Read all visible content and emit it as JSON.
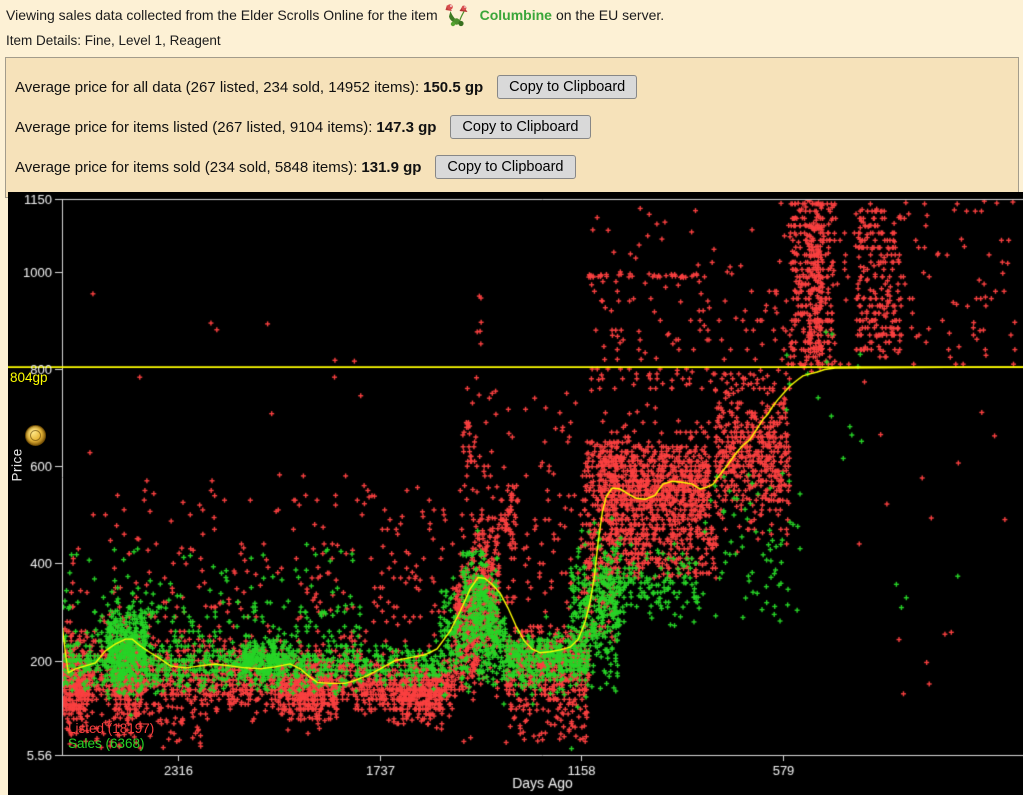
{
  "header": {
    "line1_pre": "Viewing sales data collected from the Elder Scrolls Online for the item",
    "item_name": "Columbine",
    "line1_post": " on the EU server.",
    "line2": "Item Details: Fine, Level 1, Reagent"
  },
  "stats": {
    "copy_button_label": "Copy to Clipboard",
    "rows": [
      {
        "label": "Average price for all data (267 listed, 234 sold, 14952 items):",
        "value": "150.5 gp"
      },
      {
        "label": "Average price for items listed (267 listed, 9104 items):",
        "value": "147.3 gp"
      },
      {
        "label": "Average price for items sold (234 sold, 5848 items):",
        "value": "131.9 gp"
      }
    ]
  },
  "chart_data": {
    "type": "scatter",
    "title": "",
    "xlabel": "Days Ago",
    "ylabel": "Price",
    "x_axis": {
      "label": "Days Ago",
      "ticks": [
        2316,
        1737,
        1158,
        579
      ],
      "range": [
        2650,
        -110
      ],
      "inverted": true
    },
    "y_axis": {
      "label": "Price",
      "tick_labels": [
        "1150",
        "1000",
        "800",
        "600",
        "400",
        "200",
        "5.56"
      ],
      "tick_values": [
        1150,
        1000,
        800,
        600,
        400,
        200,
        5.56
      ],
      "range": [
        5.56,
        1150
      ]
    },
    "grid": false,
    "background": "#000000",
    "axis_color": "#d8d8d8",
    "text_color": "#f2f2f2",
    "hline": {
      "value": 804,
      "label": "804gp",
      "color": "#ffff00"
    },
    "legend": [
      {
        "label": "Listed (18197)",
        "color": "#fa4040",
        "count": 18197
      },
      {
        "label": "Sales (6368)",
        "color": "#27d427",
        "count": 6368
      }
    ],
    "trend_line": {
      "color": "#ffff00",
      "points": [
        [
          2649,
          270
        ],
        [
          2640,
          215
        ],
        [
          2632,
          175
        ],
        [
          2611,
          183
        ],
        [
          2583,
          189
        ],
        [
          2554,
          195
        ],
        [
          2525,
          220
        ],
        [
          2497,
          234
        ],
        [
          2468,
          244
        ],
        [
          2448,
          244
        ],
        [
          2425,
          230
        ],
        [
          2396,
          216
        ],
        [
          2373,
          206
        ],
        [
          2339,
          189
        ],
        [
          2296,
          185
        ],
        [
          2253,
          189
        ],
        [
          2210,
          193
        ],
        [
          2167,
          189
        ],
        [
          2124,
          185
        ],
        [
          2081,
          183
        ],
        [
          2038,
          187
        ],
        [
          1995,
          193
        ],
        [
          1966,
          183
        ],
        [
          1943,
          169
        ],
        [
          1917,
          155
        ],
        [
          1880,
          153
        ],
        [
          1837,
          153
        ],
        [
          1808,
          159
        ],
        [
          1774,
          169
        ],
        [
          1736,
          183
        ],
        [
          1693,
          200
        ],
        [
          1650,
          206
        ],
        [
          1607,
          212
        ],
        [
          1573,
          224
        ],
        [
          1535,
          261
        ],
        [
          1506,
          302
        ],
        [
          1478,
          347
        ],
        [
          1455,
          371
        ],
        [
          1435,
          369
        ],
        [
          1415,
          357
        ],
        [
          1392,
          339
        ],
        [
          1369,
          308
        ],
        [
          1346,
          271
        ],
        [
          1323,
          241
        ],
        [
          1300,
          224
        ],
        [
          1277,
          216
        ],
        [
          1248,
          218
        ],
        [
          1219,
          222
        ],
        [
          1190,
          228
        ],
        [
          1167,
          244
        ],
        [
          1147,
          281
        ],
        [
          1133,
          322
        ],
        [
          1121,
          373
        ],
        [
          1110,
          445
        ],
        [
          1098,
          506
        ],
        [
          1087,
          537
        ],
        [
          1070,
          555
        ],
        [
          1047,
          553
        ],
        [
          1024,
          543
        ],
        [
          1001,
          534
        ],
        [
          975,
          532
        ],
        [
          947,
          540
        ],
        [
          924,
          563
        ],
        [
          898,
          569
        ],
        [
          869,
          567
        ],
        [
          840,
          563
        ],
        [
          817,
          553
        ],
        [
          797,
          557
        ],
        [
          780,
          563
        ],
        [
          760,
          583
        ],
        [
          737,
          604
        ],
        [
          717,
          624
        ],
        [
          697,
          641
        ],
        [
          674,
          655
        ],
        [
          654,
          677
        ],
        [
          637,
          696
        ],
        [
          622,
          708
        ],
        [
          608,
          724
        ],
        [
          594,
          737
        ],
        [
          579,
          749
        ],
        [
          559,
          765
        ],
        [
          539,
          777
        ],
        [
          522,
          786
        ],
        [
          502,
          790
        ],
        [
          481,
          794
        ],
        [
          460,
          799
        ],
        [
          430,
          802
        ],
        [
          0,
          804
        ],
        [
          -110,
          804
        ]
      ]
    },
    "scatter_clusters": [
      {
        "series": "listed",
        "days": [
          2650,
          2570
        ],
        "price": [
          150,
          45
        ],
        "dist": "gauss",
        "n": 260,
        "quant": 10
      },
      {
        "series": "listed",
        "days": [
          2650,
          1790
        ],
        "price": [
          152,
          28
        ],
        "dist": "gauss",
        "n": 900,
        "quant": 10
      },
      {
        "series": "listed",
        "days": [
          2650,
          1790
        ],
        "price": [
          205,
          22
        ],
        "dist": "gauss",
        "n": 280,
        "quant": 10
      },
      {
        "series": "listed",
        "days": [
          2500,
          2420
        ],
        "price": [
          165,
          45
        ],
        "dist": "gauss",
        "n": 220,
        "quant": 10
      },
      {
        "series": "listed",
        "days": [
          2030,
          1860
        ],
        "price": [
          130,
          28
        ],
        "dist": "gauss",
        "n": 260,
        "quant": 10
      },
      {
        "series": "listed",
        "days": [
          2650,
          1790
        ],
        "price": [
          240,
          450
        ],
        "dist": "uniform",
        "n": 150,
        "quant": 10
      },
      {
        "series": "listed",
        "days": [
          2650,
          1790
        ],
        "price": [
          450,
          580
        ],
        "dist": "uniform",
        "n": 40,
        "quant": 10
      },
      {
        "series": "listed",
        "days": [
          2650,
          1790
        ],
        "price": [
          580,
          1050
        ],
        "dist": "uniform",
        "n": 12,
        "quant": 0
      },
      {
        "series": "listed",
        "days": [
          2650,
          2250
        ],
        "price": [
          20,
          105
        ],
        "dist": "uniform",
        "n": 70,
        "quant": 0
      },
      {
        "series": "listed",
        "days": [
          1790,
          1520
        ],
        "price": [
          150,
          30
        ],
        "dist": "gauss",
        "n": 420,
        "quant": 10
      },
      {
        "series": "listed",
        "days": [
          1700,
          1555
        ],
        "price": [
          120,
          25
        ],
        "dist": "gauss",
        "n": 200,
        "quant": 10
      },
      {
        "series": "listed",
        "days": [
          1790,
          1500
        ],
        "price": [
          240,
          560
        ],
        "dist": "uniform",
        "n": 90,
        "quant": 10
      },
      {
        "series": "listed",
        "days": [
          1520,
          1460
        ],
        "price": [
          270,
          70
        ],
        "dist": "gauss",
        "n": 250,
        "quant": 0
      },
      {
        "series": "listed",
        "days": [
          1470,
          1395
        ],
        "price": [
          330,
          80
        ],
        "dist": "gauss",
        "n": 300,
        "quant": 0
      },
      {
        "series": "listed",
        "days": [
          1500,
          1420
        ],
        "price": [
          450,
          700
        ],
        "dist": "uniform",
        "n": 40,
        "quant": 10
      },
      {
        "series": "listed",
        "days": [
          1460,
          1445
        ],
        "price": [
          700,
          960
        ],
        "dist": "uniform",
        "n": 8,
        "quant": 0
      },
      {
        "series": "listed",
        "days": [
          1375,
          1135
        ],
        "price": [
          190,
          40
        ],
        "dist": "gauss",
        "n": 550,
        "quant": 10
      },
      {
        "series": "listed",
        "days": [
          1375,
          1135
        ],
        "price": [
          30,
          120
        ],
        "dist": "uniform",
        "n": 60,
        "quant": 0
      },
      {
        "series": "listed",
        "days": [
          1375,
          1135
        ],
        "price": [
          300,
          560
        ],
        "dist": "uniform",
        "n": 70,
        "quant": 10
      },
      {
        "series": "listed",
        "days": [
          1395,
          1340
        ],
        "price": [
          430,
          560
        ],
        "dist": "uniform",
        "n": 50,
        "quant": 10
      },
      {
        "series": "listed",
        "days": [
          1150,
          1055
        ],
        "price": [
          240,
          650
        ],
        "dist": "uniform",
        "n": 260,
        "quant": 10
      },
      {
        "series": "listed",
        "days": [
          1105,
          790
        ],
        "price": [
          560,
          55
        ],
        "dist": "gauss",
        "n": 950,
        "quant": 10
      },
      {
        "series": "listed",
        "days": [
          1085,
          770
        ],
        "price": [
          370,
          475
        ],
        "dist": "uniform",
        "n": 230,
        "quant": 10
      },
      {
        "series": "listed",
        "days": [
          775,
          560
        ],
        "price": [
          625,
          70
        ],
        "dist": "gauss",
        "n": 520,
        "quant": 10
      },
      {
        "series": "listed",
        "days": [
          1150,
          560
        ],
        "price": [
          755,
          800
        ],
        "dist": "uniform",
        "n": 60,
        "quant": 10
      },
      {
        "series": "listed",
        "days": [
          1150,
          560
        ],
        "price": [
          810,
          1000
        ],
        "dist": "uniform",
        "n": 90,
        "quant": 20
      },
      {
        "series": "listed",
        "days": [
          1140,
          790
        ],
        "price": [
          988,
          996
        ],
        "dist": "uniform",
        "n": 40,
        "quant": 0
      },
      {
        "series": "listed",
        "days": [
          1150,
          560
        ],
        "price": [
          1000,
          1150
        ],
        "dist": "uniform",
        "n": 25,
        "quant": 0
      },
      {
        "series": "listed",
        "days": [
          560,
          430
        ],
        "price": [
          800,
          1150
        ],
        "dist": "uniform",
        "n": 330,
        "quant": 15
      },
      {
        "series": "listed",
        "days": [
          505,
          465
        ],
        "price": [
          820,
          1150
        ],
        "dist": "uniform",
        "n": 120,
        "quant": 0
      },
      {
        "series": "listed",
        "days": [
          370,
          240
        ],
        "price": [
          830,
          1130
        ],
        "dist": "uniform",
        "n": 220,
        "quant": 15
      },
      {
        "series": "listed",
        "days": [
          430,
          -90
        ],
        "price": [
          800,
          1150
        ],
        "dist": "uniform",
        "n": 110,
        "quant": 15
      },
      {
        "series": "listed",
        "days": [
          415,
          -80
        ],
        "price": [
          430,
          790
        ],
        "dist": "uniform",
        "n": 10,
        "quant": 0
      },
      {
        "series": "listed",
        "days": [
          250,
          60
        ],
        "price": [
          120,
          260
        ],
        "dist": "uniform",
        "n": 6,
        "quant": 0
      },
      {
        "series": "listed",
        "days": [
          1500,
          1150
        ],
        "price": [
          560,
          760
        ],
        "dist": "uniform",
        "n": 40,
        "quant": 10
      },
      {
        "series": "sales",
        "days": [
          2650,
          1790
        ],
        "price": [
          195,
          18
        ],
        "dist": "gauss",
        "n": 550,
        "quant": 10
      },
      {
        "series": "sales",
        "days": [
          2520,
          2405
        ],
        "price": [
          230,
          45
        ],
        "dist": "gauss",
        "n": 380,
        "quant": 0
      },
      {
        "series": "sales",
        "days": [
          2650,
          1790
        ],
        "price": [
          225,
          330
        ],
        "dist": "uniform",
        "n": 160,
        "quant": 10
      },
      {
        "series": "sales",
        "days": [
          2650,
          1790
        ],
        "price": [
          330,
          440
        ],
        "dist": "uniform",
        "n": 50,
        "quant": 0
      },
      {
        "series": "sales",
        "days": [
          2130,
          1990
        ],
        "price": [
          200,
          20
        ],
        "dist": "gauss",
        "n": 200,
        "quant": 0
      },
      {
        "series": "sales",
        "days": [
          1790,
          1530
        ],
        "price": [
          190,
          20
        ],
        "dist": "gauss",
        "n": 160,
        "quant": 10
      },
      {
        "series": "sales",
        "days": [
          1565,
          1375
        ],
        "price": [
          250,
          55
        ],
        "dist": "gauss",
        "n": 300,
        "quant": 0
      },
      {
        "series": "sales",
        "days": [
          1470,
          1400
        ],
        "price": [
          300,
          60
        ],
        "dist": "gauss",
        "n": 120,
        "quant": 0
      },
      {
        "series": "sales",
        "days": [
          1375,
          1135
        ],
        "price": [
          200,
          28
        ],
        "dist": "gauss",
        "n": 380,
        "quant": 10
      },
      {
        "series": "sales",
        "days": [
          1190,
          1045
        ],
        "price": [
          300,
          70
        ],
        "dist": "gauss",
        "n": 320,
        "quant": 0
      },
      {
        "series": "sales",
        "days": [
          1105,
          815
        ],
        "price": [
          350,
          40
        ],
        "dist": "gauss",
        "n": 170,
        "quant": 10
      },
      {
        "series": "sales",
        "days": [
          815,
          530
        ],
        "price": [
          280,
          590
        ],
        "dist": "uniform",
        "n": 70,
        "quant": 0
      },
      {
        "series": "sales",
        "days": [
          600,
          330
        ],
        "price": [
          590,
          880
        ],
        "dist": "uniform",
        "n": 15,
        "quant": 0
      },
      {
        "series": "sales",
        "days": [
          330,
          60
        ],
        "price": [
          300,
          420
        ],
        "dist": "uniform",
        "n": 4,
        "quant": 0
      },
      {
        "series": "sales",
        "days": [
          2650,
          1790
        ],
        "price": [
          130,
          175
        ],
        "dist": "uniform",
        "n": 120,
        "quant": 0
      },
      {
        "series": "sales",
        "days": [
          1500,
          1430
        ],
        "price": [
          330,
          430
        ],
        "dist": "uniform",
        "n": 60,
        "quant": 0
      }
    ]
  }
}
